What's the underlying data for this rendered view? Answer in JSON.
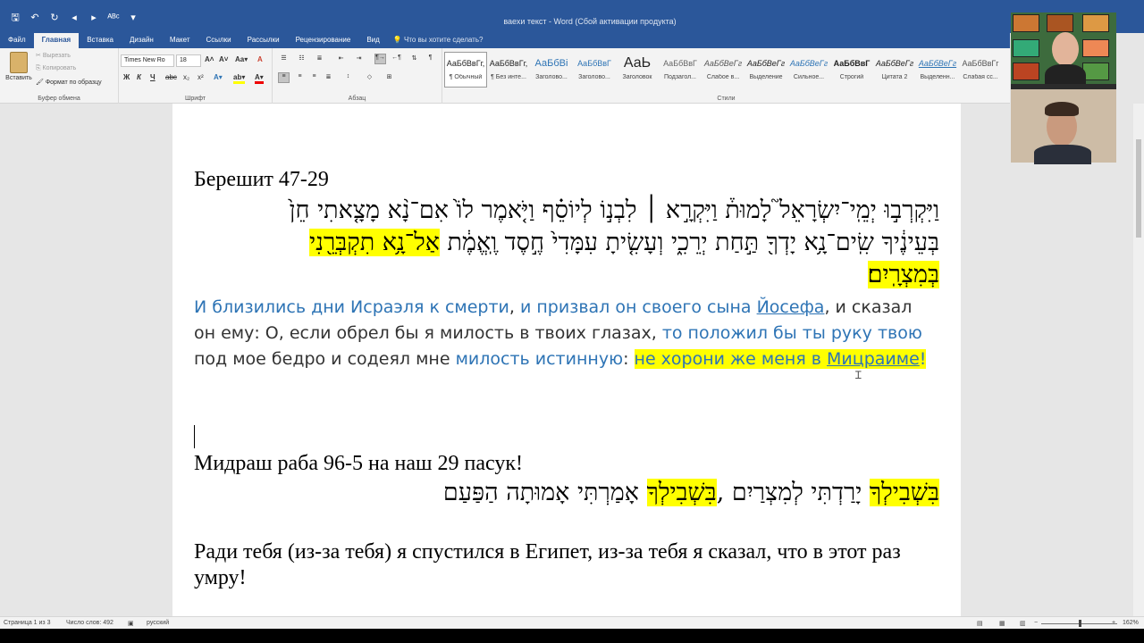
{
  "window": {
    "title": "ваехи текст - Word (Сбой активации продукта)"
  },
  "qat": {
    "icons": [
      "save-icon",
      "undo-icon",
      "redo-icon",
      "back-icon",
      "forward-icon",
      "spellcheck-icon",
      "more-icon"
    ],
    "glyphs": [
      "🖫",
      "↶",
      "↻",
      "◂",
      "▸",
      "ᴬᴮᶜ",
      "▾"
    ]
  },
  "tabs": [
    "Файл",
    "Главная",
    "Вставка",
    "Дизайн",
    "Макет",
    "Ссылки",
    "Рассылки",
    "Рецензирование",
    "Вид"
  ],
  "tell_me": "Что вы хотите сделать?",
  "ribbon": {
    "clipboard": {
      "paste": "Вставить",
      "cut": "Вырезать",
      "copy": "Копировать",
      "format_painter": "Формат по образцу",
      "label": "Буфер обмена"
    },
    "font": {
      "name": "Times New Ro",
      "size": "18",
      "label": "Шрифт"
    },
    "paragraph": {
      "label": "Абзац"
    },
    "styles": {
      "label": "Стили",
      "items": [
        {
          "preview": "АаБбВвГг,",
          "name": "¶ Обычный"
        },
        {
          "preview": "АаБбВвГг,",
          "name": "¶ Без инте..."
        },
        {
          "preview": "АаБбВі",
          "name": "Заголово..."
        },
        {
          "preview": "АаБбВвГ",
          "name": "Заголово..."
        },
        {
          "preview": "АаЬ",
          "name": "Заголовок"
        },
        {
          "preview": "АаБбВвГ",
          "name": "Подзагол..."
        },
        {
          "preview": "АаБбВеГг",
          "name": "Слабое в..."
        },
        {
          "preview": "АаБбВеГг",
          "name": "Выделение"
        },
        {
          "preview": "АаБбВеГг",
          "name": "Сильное..."
        },
        {
          "preview": "АаБбВвГ",
          "name": "Строгий"
        },
        {
          "preview": "АаБбВеГг",
          "name": "Цитата 2"
        },
        {
          "preview": "АаБбВеГг",
          "name": "Выделенн..."
        },
        {
          "preview": "АаБбВвГг",
          "name": "Слабая сс..."
        }
      ]
    }
  },
  "document": {
    "heading1": "Берешит 47-29",
    "hebrew_line1": "וַיִּקְרְב֣וּ יְמֵֽי־יִשְׂרָאֵל֮ לָמוּת֒ וַיִּקְרָ֣א ׀ לִבְנ֣וֹ לְיוֹסֵ֗ף וַיֹּ֤אמֶר לוֹ֙ אִם־נָ֨א מָצָ֤אתִי חֵן֙",
    "hebrew_line2_plain": "בְּעֵינֶ֔יךָ שִֽׂים־נָ֥א יָדְךָ֖ תַּ֣חַת יְרֵכִ֑י וְעָשִׂ֤יתָ עִמָּדִי֙ חֶ֣סֶד וֶֽאֱמֶ֔ת",
    "hebrew_line2_hl": "אַל־נָ֥א תִקְבְּרֵ֖נִי",
    "hebrew_line3_hl": "בְּמִצְרָֽיִם׃",
    "ru1_a": " И близились дни Исраэля к смерти",
    "ru1_b": ", ",
    "ru1_c": "и призвал он своего сына ",
    "ru1_d": "Йосефа",
    "ru1_e": ", и сказал он ему: О, если обрел бы я милость в твоих глазах, ",
    "ru1_f": "то положил бы ты руку твою",
    "ru1_g": " под мое бедро и содеял мне ",
    "ru1_h": "милость истинную",
    "ru1_i": ": ",
    "ru1_j": "не хорони же меня в ",
    "ru1_k": "Мицраиме",
    "ru1_l": "!",
    "heading2": "Мидраш раба 96-5 на наш 29 пасук!",
    "hebrew2_hl1": "בִּשְׁבִילְךָ",
    "hebrew2_a": " יָרַדְתִּי לְמִצְרַיִם ,",
    "hebrew2_hl2": "בִּשְׁבִילְךָ",
    "hebrew2_b": " אָמַרְתִּי  אָמוּתָה הַפַּעַם",
    "ru2": "Ради тебя (из-за тебя) я спустился в Египет, из-за тебя я сказал, что в этот раз умру!"
  },
  "status": {
    "page": "Страница 1 из 3",
    "words": "Число слов: 492",
    "lang": "русский",
    "zoom": "162%"
  }
}
